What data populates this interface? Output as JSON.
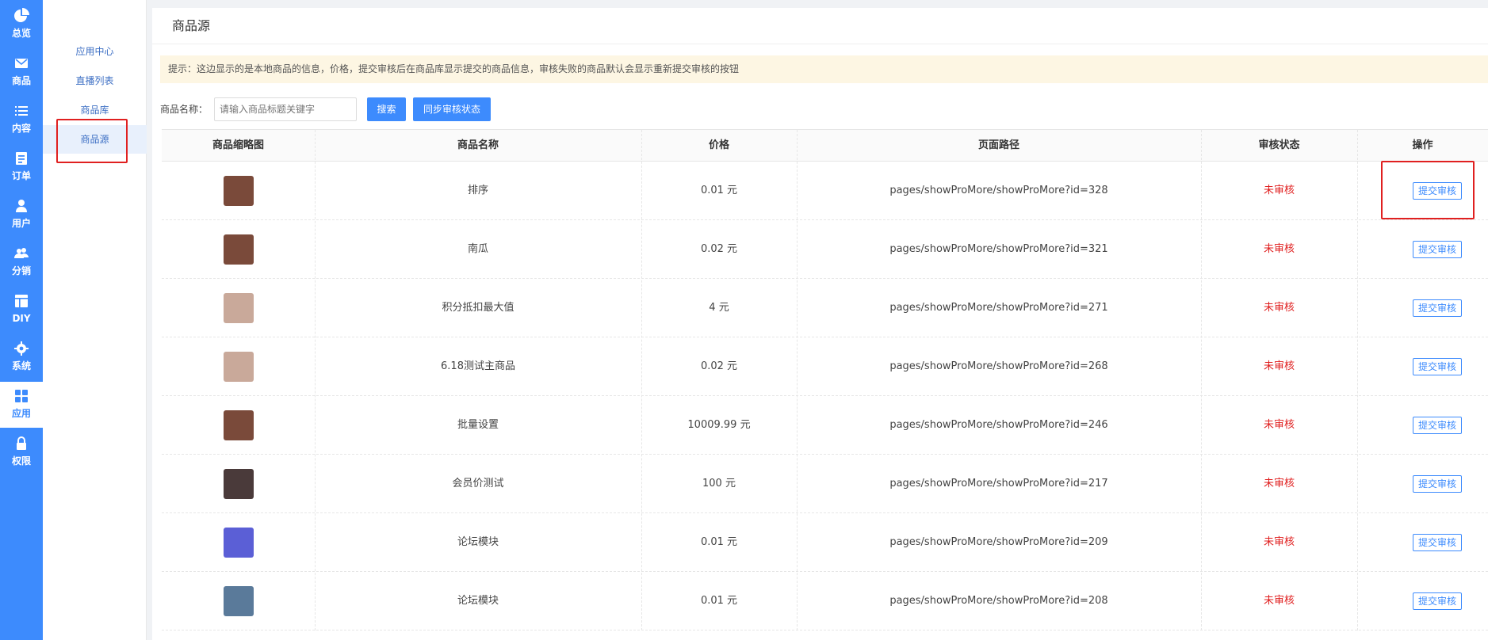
{
  "sidebar": {
    "items": [
      {
        "label": "总览",
        "icon": "pie-chart-icon"
      },
      {
        "label": "商品",
        "icon": "mail-icon"
      },
      {
        "label": "内容",
        "icon": "list-icon"
      },
      {
        "label": "订单",
        "icon": "document-icon"
      },
      {
        "label": "用户",
        "icon": "user-icon"
      },
      {
        "label": "分销",
        "icon": "users-icon"
      },
      {
        "label": "DIY",
        "icon": "layout-icon"
      },
      {
        "label": "系统",
        "icon": "gear-icon"
      },
      {
        "label": "应用",
        "icon": "grid-icon"
      },
      {
        "label": "权限",
        "icon": "lock-icon"
      }
    ],
    "active_index": 8
  },
  "subnav": {
    "items": [
      "应用中心",
      "直播列表",
      "商品库",
      "商品源"
    ],
    "active_index": 3
  },
  "main": {
    "title": "商品源",
    "tip": "提示：这边显示的是本地商品的信息，价格，提交审核后在商品库显示提交的商品信息，审核失败的商品默认会显示重新提交审核的按钮",
    "search": {
      "label": "商品名称：",
      "placeholder": "请输入商品标题关键字",
      "search_button": "搜索",
      "sync_button": "同步审核状态"
    }
  },
  "table": {
    "columns": [
      "商品缩略图",
      "商品名称",
      "价格",
      "页面路径",
      "审核状态",
      "操作"
    ],
    "rows": [
      {
        "name": "排序",
        "price": "0.01 元",
        "path": "pages/showProMore/showProMore?id=328",
        "status": "未审核",
        "action": "提交审核",
        "thumb_color": "#7a4a3a"
      },
      {
        "name": "南瓜",
        "price": "0.02 元",
        "path": "pages/showProMore/showProMore?id=321",
        "status": "未审核",
        "action": "提交审核",
        "thumb_color": "#7a4a3a"
      },
      {
        "name": "积分抵扣最大值",
        "price": "4 元",
        "path": "pages/showProMore/showProMore?id=271",
        "status": "未审核",
        "action": "提交审核",
        "thumb_color": "#c9a99a"
      },
      {
        "name": "6.18测试主商品",
        "price": "0.02 元",
        "path": "pages/showProMore/showProMore?id=268",
        "status": "未审核",
        "action": "提交审核",
        "thumb_color": "#c9a99a"
      },
      {
        "name": "批量设置",
        "price": "10009.99 元",
        "path": "pages/showProMore/showProMore?id=246",
        "status": "未审核",
        "action": "提交审核",
        "thumb_color": "#7a4a3a"
      },
      {
        "name": "会员价测试",
        "price": "100 元",
        "path": "pages/showProMore/showProMore?id=217",
        "status": "未审核",
        "action": "提交审核",
        "thumb_color": "#4a3a3a"
      },
      {
        "name": "论坛模块",
        "price": "0.01 元",
        "path": "pages/showProMore/showProMore?id=209",
        "status": "未审核",
        "action": "提交审核",
        "thumb_color": "#5b5fd6"
      },
      {
        "name": "论坛模块",
        "price": "0.01 元",
        "path": "pages/showProMore/showProMore?id=208",
        "status": "未审核",
        "action": "提交审核",
        "thumb_color": "#5a7a9a"
      }
    ]
  },
  "colors": {
    "accent": "#3d8bfd",
    "status_unreviewed": "#e02020",
    "highlight_box": "#e02020"
  }
}
